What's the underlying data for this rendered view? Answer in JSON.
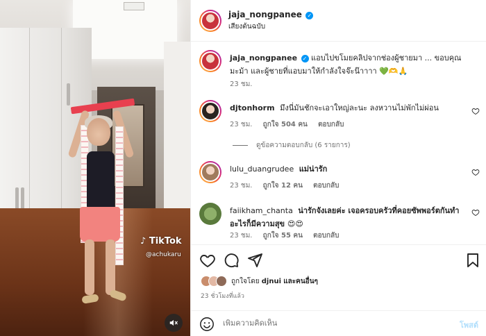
{
  "media": {
    "watermark_brand": "TikTok",
    "watermark_user": "@achukaru",
    "mute_icon": "speaker-muted-icon"
  },
  "header": {
    "username": "jaja_nongpanee",
    "verified": true,
    "subtitle": "เสียงต้นฉบับ"
  },
  "caption": {
    "username": "jaja_nongpanee",
    "text": "แอบไปขโมยคลิปจากช่องผู้ชายมา ... ขอบคุณมะม้า และผู้ชายที่แอบมาให้กำลังใจจ๊ะน๊าาาา 💚🫶🙏",
    "time": "23 ชม."
  },
  "comments": [
    {
      "username": "djtonhorm",
      "text": "มึงนี่มันชักจะเอาใหญ่ละนะ ลงหวานไม่พักไม่ผ่อน",
      "time": "23 ชม.",
      "likes": "ถูกใจ 504 คน",
      "reply": "ตอบกลับ"
    },
    {
      "username": "lulu_duangrudee",
      "text": "แม่น่ารัก",
      "time": "23 ชม.",
      "likes": "ถูกใจ 12 คน",
      "reply": "ตอบกลับ"
    },
    {
      "username": "faiikham_chanta",
      "text": "น่ารักจังเลยค่ะ เจอครอบครัวที่คอยซัพพอร์ตกันทำอะไรก็มีความสุข 😍😍",
      "time": "23 ชม.",
      "likes": "ถูกใจ 55 คน",
      "reply": "ตอบกลับ"
    }
  ],
  "view_replies": "ดูข้อความตอบกลับ (6 รายการ)",
  "liked_by": {
    "prefix": "ถูกใจโดย",
    "user": "djnui",
    "suffix": "และคนอื่นๆ"
  },
  "time_ago": "23 ชั่วโมงที่แล้ว",
  "comment_box": {
    "placeholder": "เพิ่มความคิดเห็น",
    "post_label": "โพสต์"
  },
  "colors": {
    "verified": "#0095f6",
    "post_disabled": "#b2dffc",
    "meta": "#737373"
  }
}
